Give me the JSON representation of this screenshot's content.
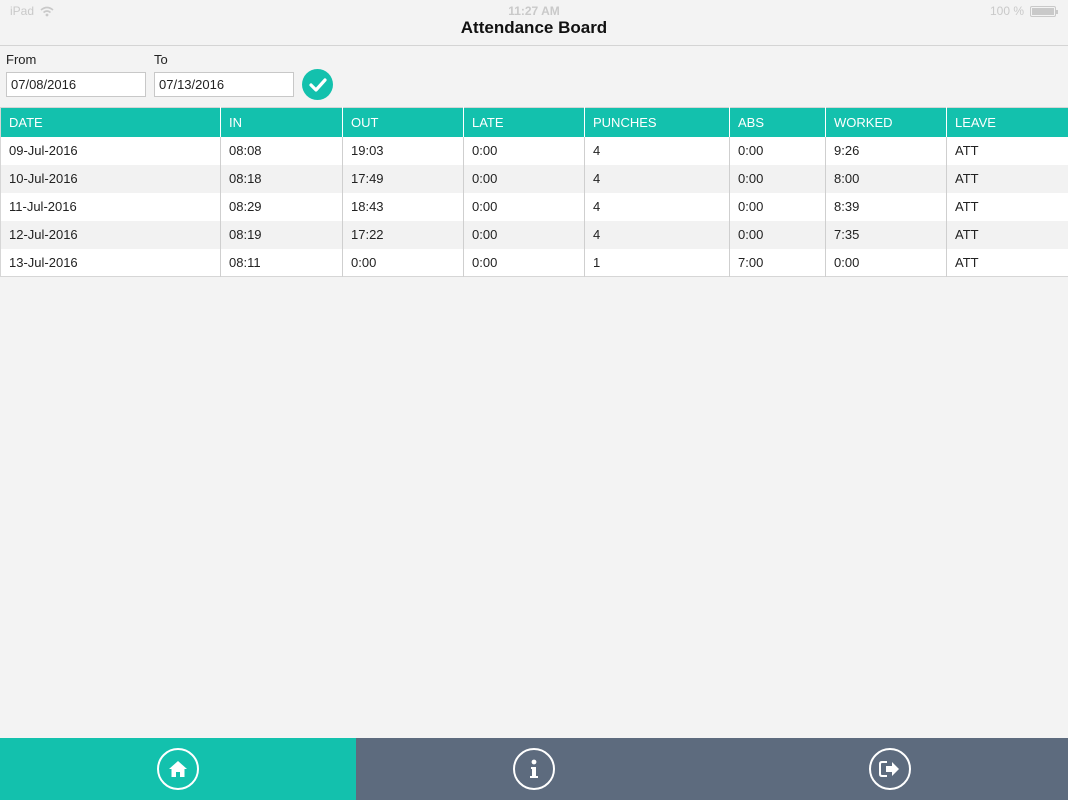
{
  "status_bar": {
    "carrier": "iPad",
    "time": "11:27 AM",
    "battery": "100 %",
    "battery_level": 1.0
  },
  "title": "Attendance Board",
  "filters": {
    "from_label": "From",
    "from_value": "07/08/2016",
    "to_label": "To",
    "to_value": "07/13/2016",
    "apply_icon": "check-circle-icon"
  },
  "table": {
    "columns": [
      "DATE",
      "IN",
      "OUT",
      "LATE",
      "PUNCHES",
      "ABS",
      "WORKED",
      "LEAVE"
    ],
    "rows": [
      [
        "09-Jul-2016",
        "08:08",
        "19:03",
        "0:00",
        "4",
        "0:00",
        "9:26",
        "ATT"
      ],
      [
        "10-Jul-2016",
        "08:18",
        "17:49",
        "0:00",
        "4",
        "0:00",
        "8:00",
        "ATT"
      ],
      [
        "11-Jul-2016",
        "08:29",
        "18:43",
        "0:00",
        "4",
        "0:00",
        "8:39",
        "ATT"
      ],
      [
        "12-Jul-2016",
        "08:19",
        "17:22",
        "0:00",
        "4",
        "0:00",
        "7:35",
        "ATT"
      ],
      [
        "13-Jul-2016",
        "08:11",
        "0:00",
        "0:00",
        "1",
        "7:00",
        "0:00",
        "ATT"
      ]
    ]
  },
  "tabbar": {
    "tabs": [
      {
        "icon": "home-icon",
        "active": true
      },
      {
        "icon": "info-icon",
        "active": false
      },
      {
        "icon": "logout-icon",
        "active": false
      }
    ]
  },
  "colors": {
    "accent": "#13c1ad",
    "tabbar_inactive": "#5d6b7e",
    "background": "#f3f3f3"
  }
}
